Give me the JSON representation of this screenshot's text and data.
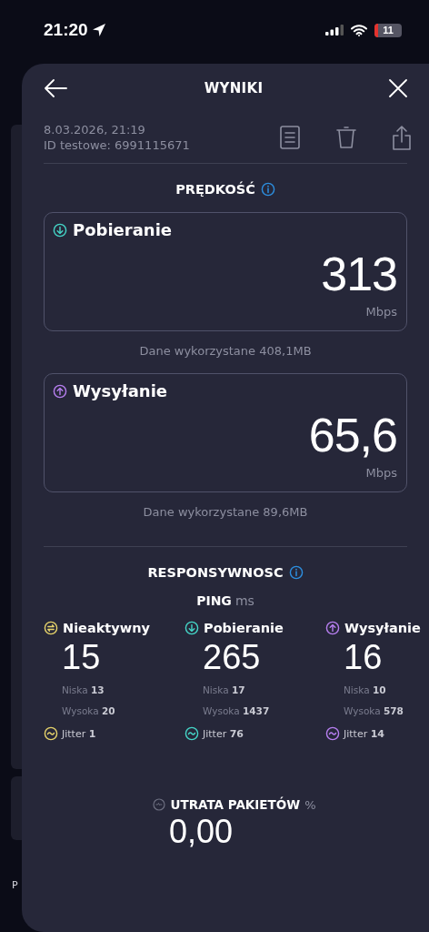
{
  "status_bar": {
    "time": "21:20",
    "battery": "11"
  },
  "background": {
    "text": "P"
  },
  "header": {
    "title": "WYNIKI"
  },
  "meta": {
    "date": "8.03.2026, 21:19",
    "test_id": "ID testowe: 6991115671"
  },
  "speed": {
    "title": "PRĘDKOŚĆ",
    "cards": [
      {
        "kind": "download",
        "label": "Pobieranie",
        "value": "313",
        "unit": "Mbps",
        "data_used": "Dane wykorzystane 408,1MB",
        "color": "#45d6c8"
      },
      {
        "kind": "upload",
        "label": "Wysyłanie",
        "value": "65,6",
        "unit": "Mbps",
        "data_used": "Dane wykorzystane 89,6MB",
        "color": "#b77ff0"
      }
    ]
  },
  "responsiveness": {
    "title": "RESPONSYWNOSC",
    "ping_label": "PING",
    "ping_unit": "ms",
    "columns": [
      {
        "kind": "idle",
        "label": "Nieaktywny",
        "value": "15",
        "low_label": "Niska",
        "low": "13",
        "high_label": "Wysoka",
        "high": "20",
        "jitter_label": "Jitter",
        "jitter": "1",
        "color": "#e6d36b"
      },
      {
        "kind": "download",
        "label": "Pobieranie",
        "value": "265",
        "low_label": "Niska",
        "low": "17",
        "high_label": "Wysoka",
        "high": "1437",
        "jitter_label": "Jitter",
        "jitter": "76",
        "color": "#45d6c8"
      },
      {
        "kind": "upload",
        "label": "Wysyłanie",
        "value": "16",
        "low_label": "Niska",
        "low": "10",
        "high_label": "Wysoka",
        "high": "578",
        "jitter_label": "Jitter",
        "jitter": "14",
        "color": "#b77ff0"
      }
    ]
  },
  "packet_loss": {
    "label": "UTRATA PAKIETÓW",
    "unit": "%",
    "value": "0,00"
  }
}
